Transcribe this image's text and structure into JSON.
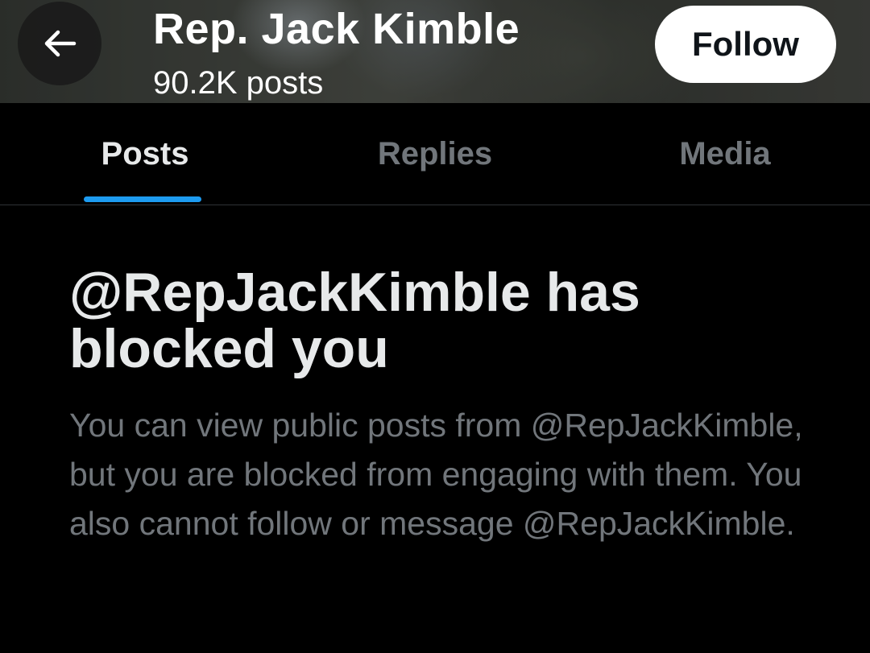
{
  "header": {
    "back_icon": "arrow-left-icon",
    "name": "Rep. Jack Kimble",
    "posts_count": "90.2K posts",
    "follow_label": "Follow"
  },
  "tabs": [
    {
      "label": "Posts",
      "active": true
    },
    {
      "label": "Replies",
      "active": false
    },
    {
      "label": "Media",
      "active": false
    }
  ],
  "blocked": {
    "title": "@RepJackKimble has blocked you",
    "body": "You can view public posts from @RepJackKimble, but you are blocked from engaging with them. You also cannot follow or message @RepJackKimble."
  },
  "colors": {
    "background": "#000000",
    "accent": "#1d9bf0",
    "primary_text": "#e7e9ea",
    "secondary_text": "#71767b",
    "follow_button_bg": "#ffffff"
  }
}
